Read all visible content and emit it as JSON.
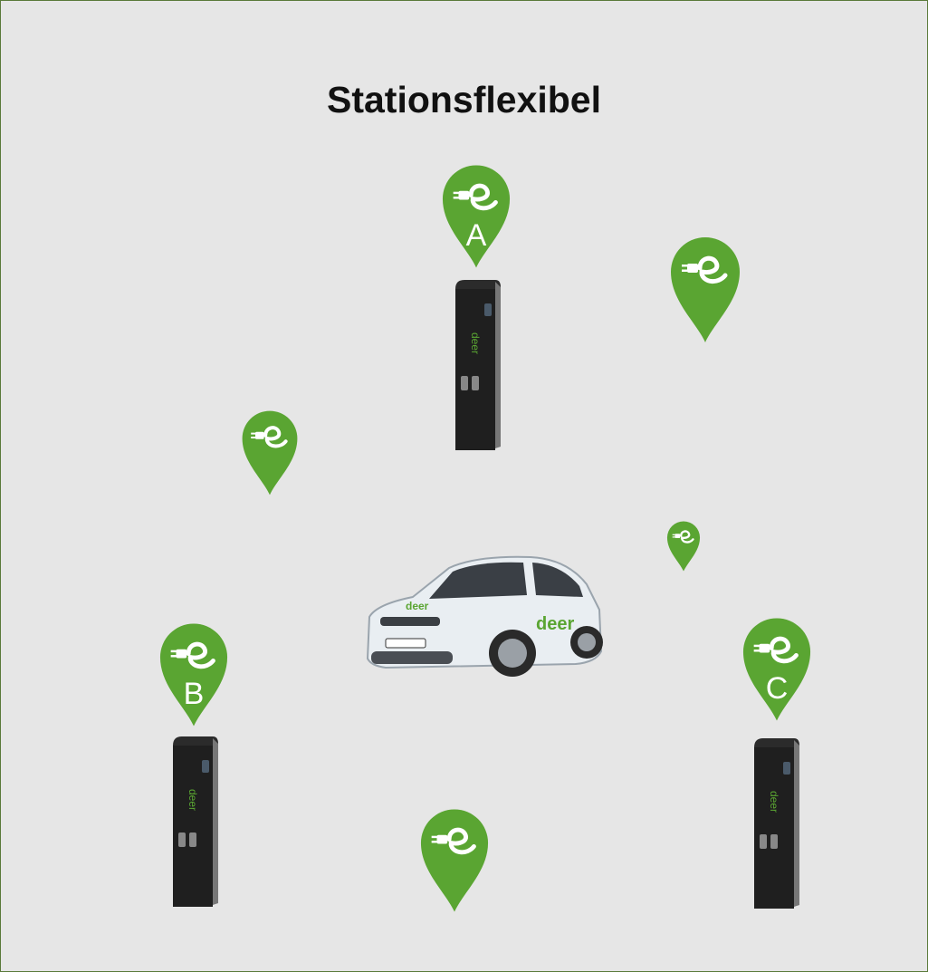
{
  "title": "Stationsflexibel",
  "colors": {
    "background": "#e6e6e6",
    "pin_green": "#5aa532",
    "station_dark": "#2b2b2b",
    "frame_border": "#5a7a3a"
  },
  "pins": [
    {
      "id": "A",
      "label": "A",
      "icon": "plug-logo-icon"
    },
    {
      "id": "top-right",
      "label": "",
      "icon": "plug-logo-icon"
    },
    {
      "id": "left",
      "label": "",
      "icon": "plug-logo-icon"
    },
    {
      "id": "small",
      "label": "",
      "icon": "plug-logo-icon"
    },
    {
      "id": "B",
      "label": "B",
      "icon": "plug-logo-icon"
    },
    {
      "id": "C",
      "label": "C",
      "icon": "plug-logo-icon"
    },
    {
      "id": "bottom",
      "label": "",
      "icon": "plug-logo-icon"
    }
  ],
  "stations": [
    {
      "id": "A",
      "icon": "charging-station-icon"
    },
    {
      "id": "B",
      "icon": "charging-station-icon"
    },
    {
      "id": "C",
      "icon": "charging-station-icon"
    }
  ],
  "car": {
    "icon": "electric-car-icon"
  }
}
